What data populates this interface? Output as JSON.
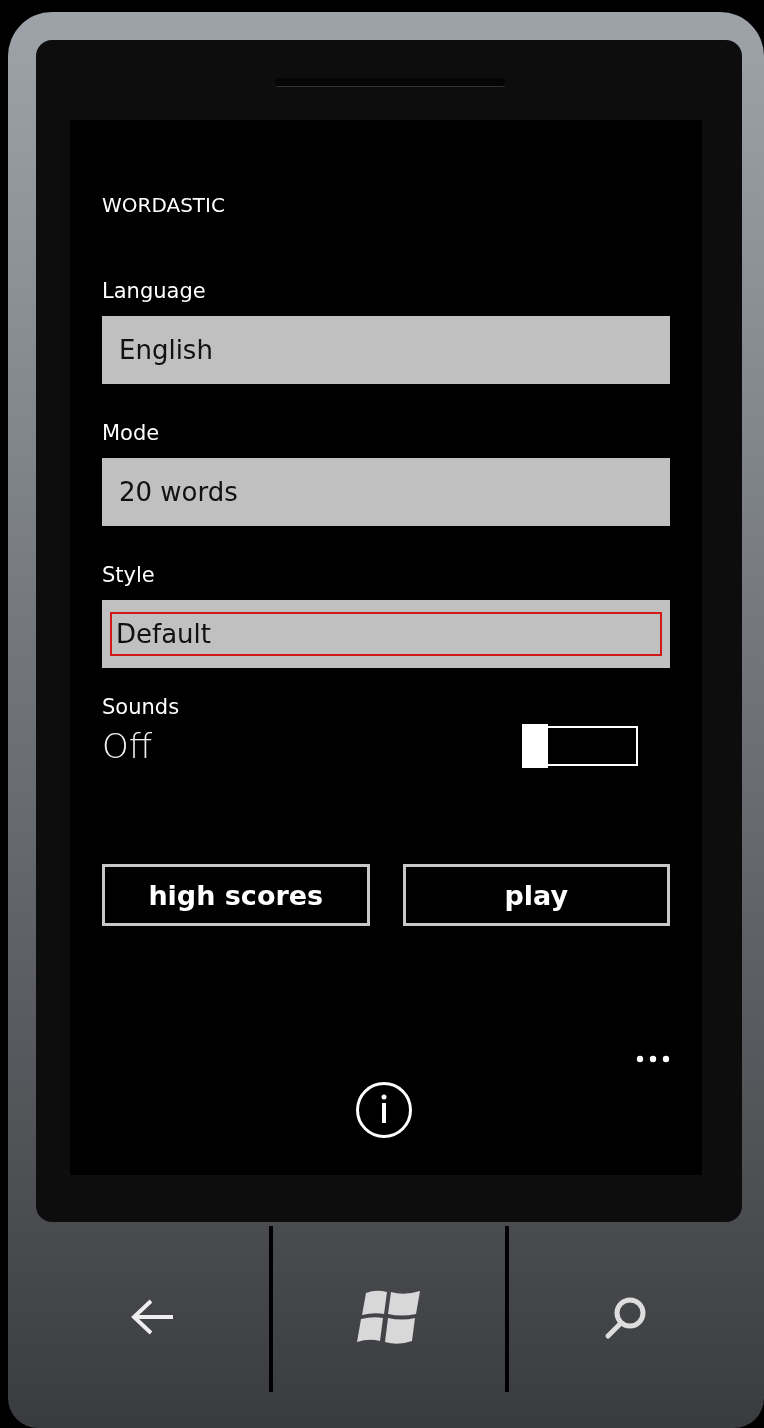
{
  "app_title": "WORDASTIC",
  "settings": [
    {
      "kind": "picker",
      "label": "Language",
      "value": "English",
      "focused": false
    },
    {
      "kind": "picker",
      "label": "Mode",
      "value": "20 words",
      "focused": false
    },
    {
      "kind": "picker",
      "label": "Style",
      "value": "Default",
      "focused": true
    },
    {
      "kind": "toggle",
      "label": "Sounds",
      "value": "Off",
      "on": false
    }
  ],
  "buttons": [
    {
      "label": "high scores"
    },
    {
      "label": "play"
    }
  ]
}
